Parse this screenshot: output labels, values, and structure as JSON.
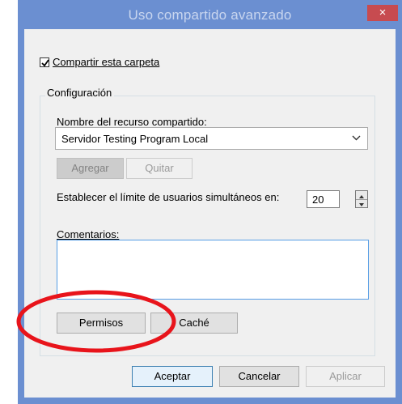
{
  "window": {
    "title": "Uso compartido avanzado",
    "close_glyph": "×"
  },
  "share_checkbox": {
    "label": "Compartir esta carpeta",
    "checked": true
  },
  "group": {
    "legend": "Configuración",
    "share_name_label": "Nombre del recurso compartido:",
    "share_name_value": "Servidor Testing Program Local",
    "add_button": "Agregar",
    "remove_button": "Quitar",
    "limit_label": "Establecer el límite de usuarios simultáneos en:",
    "limit_value": "20",
    "comments_label": "Comentarios:",
    "comments_value": "",
    "permissions_button": "Permisos",
    "cache_button": "Caché"
  },
  "footer": {
    "ok_button": "Aceptar",
    "cancel_button": "Cancelar",
    "apply_button": "Aplicar"
  },
  "annotation": {
    "color": "#e8141b",
    "shape": "ellipse"
  },
  "colors": {
    "titlebar": "#6b8fd1",
    "close_button": "#c74b50",
    "dialog_body": "#f0f0f0"
  }
}
